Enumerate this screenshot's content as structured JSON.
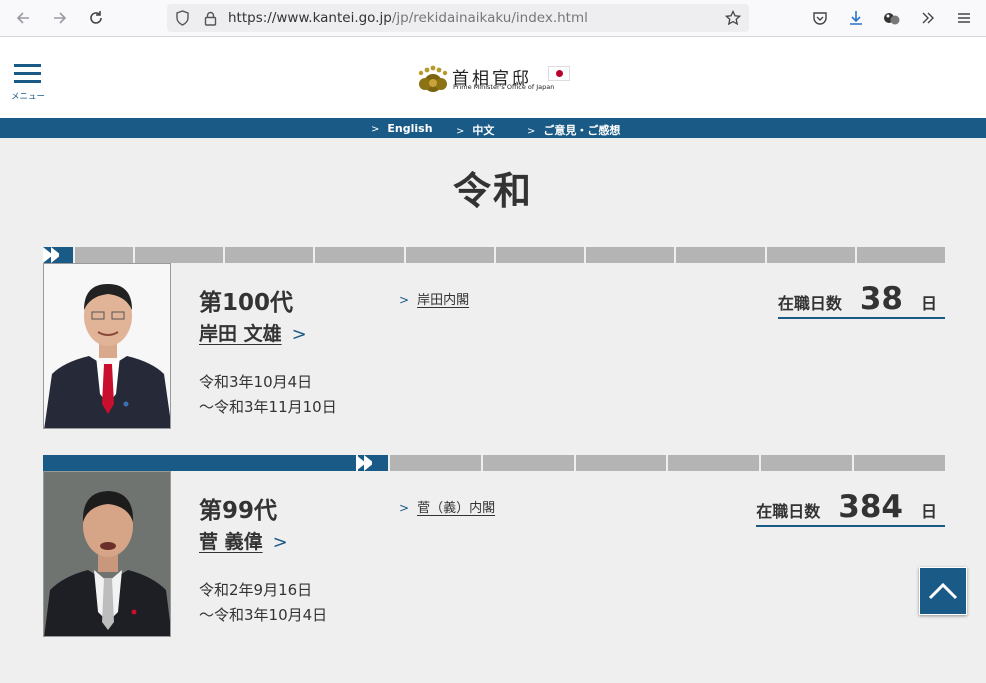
{
  "browser": {
    "url_domain": "https://www.kantei.go.jp",
    "url_path": "/jp/rekidainaikaku/index.html"
  },
  "header": {
    "menu_label": "メニュー",
    "logo_jp": "首相官邸",
    "logo_en": "Prime Minister's Office of Japan"
  },
  "langbar": {
    "items": [
      {
        "label": "English"
      },
      {
        "label": "中文"
      },
      {
        "label": "ご意見・ご感想"
      }
    ]
  },
  "era": {
    "title": "令和"
  },
  "cabinets": [
    {
      "order": "第100代",
      "name": "岸田 文雄",
      "cabinet_link": "岸田内閣",
      "date_start": "令和3年10月4日",
      "date_end": "～令和3年11月10日",
      "days_label": "在職日数",
      "days": "38",
      "days_unit": "日"
    },
    {
      "order": "第99代",
      "name": "菅 義偉",
      "cabinet_link": "菅（義）内閣",
      "date_start": "令和2年9月16日",
      "date_end": "～令和3年10月4日",
      "days_label": "在職日数",
      "days": "384",
      "days_unit": "日"
    }
  ],
  "colors": {
    "accent": "#1a5a86",
    "timeline_gray": "#b4b4b4",
    "background": "#efefef"
  },
  "icons": [
    "back-arrow-icon",
    "forward-arrow-icon",
    "reload-icon",
    "shield-icon",
    "lock-icon",
    "bookmark-star-icon",
    "pocket-icon",
    "download-icon",
    "extensions-icon",
    "overflow-chevron-icon",
    "hamburger-menu-icon",
    "chevron-up-icon"
  ]
}
